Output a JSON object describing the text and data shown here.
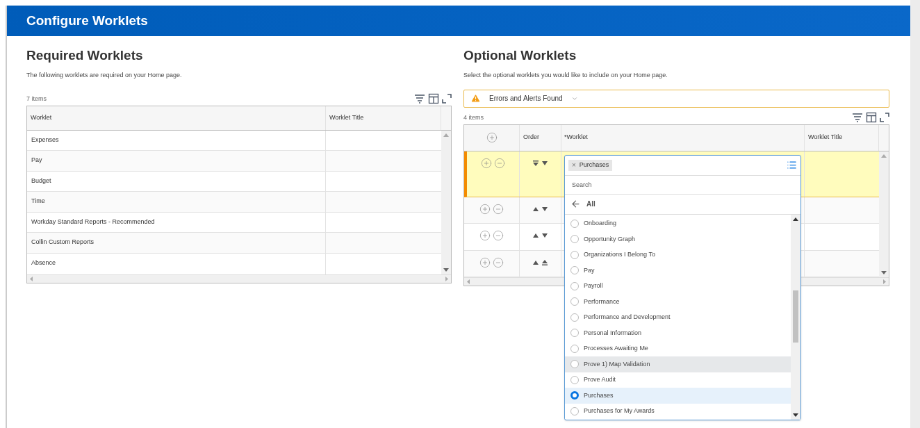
{
  "header": {
    "title": "Configure Worklets"
  },
  "required": {
    "title": "Required Worklets",
    "description": "The following worklets are required on your Home page.",
    "count": "7 items",
    "columns": [
      "Worklet",
      "Worklet Title"
    ],
    "rows": [
      {
        "worklet": "Expenses"
      },
      {
        "worklet": "Pay"
      },
      {
        "worklet": "Budget"
      },
      {
        "worklet": "Time"
      },
      {
        "worklet": "Workday Standard Reports - Recommended"
      },
      {
        "worklet": "Collin Custom Reports"
      },
      {
        "worklet": "Absence"
      }
    ]
  },
  "optional": {
    "title": "Optional Worklets",
    "description": "Select the optional worklets you would like to include on your Home page.",
    "alert": "Errors and Alerts Found",
    "count": "4 items",
    "columns": [
      "Order",
      "*Worklet",
      "Worklet Title"
    ],
    "rows": [
      {
        "selected": true,
        "order": [
          {
            "kind": "top"
          },
          {
            "kind": "down"
          }
        ]
      },
      {
        "selected": false,
        "order": [
          {
            "kind": "up"
          },
          {
            "kind": "down"
          }
        ]
      },
      {
        "selected": false,
        "order": [
          {
            "kind": "up"
          },
          {
            "kind": "down"
          }
        ]
      },
      {
        "selected": false,
        "order": [
          {
            "kind": "up"
          },
          {
            "kind": "bottom"
          }
        ]
      }
    ],
    "dropdown": {
      "chip": "Purchases",
      "chip_remove": "×",
      "search_placeholder": "Search",
      "back_label": "All",
      "options": [
        {
          "label": "Onboarding",
          "selected": false,
          "hovered": false
        },
        {
          "label": "Opportunity Graph",
          "selected": false,
          "hovered": false
        },
        {
          "label": "Organizations I Belong To",
          "selected": false,
          "hovered": false
        },
        {
          "label": "Pay",
          "selected": false,
          "hovered": false
        },
        {
          "label": "Payroll",
          "selected": false,
          "hovered": false
        },
        {
          "label": "Performance",
          "selected": false,
          "hovered": false
        },
        {
          "label": "Performance and Development",
          "selected": false,
          "hovered": false
        },
        {
          "label": "Personal Information",
          "selected": false,
          "hovered": false
        },
        {
          "label": "Processes Awaiting Me",
          "selected": false,
          "hovered": false
        },
        {
          "label": "Prove 1) Map Validation",
          "selected": false,
          "hovered": true
        },
        {
          "label": "Prove Audit",
          "selected": false,
          "hovered": false
        },
        {
          "label": "Purchases",
          "selected": true,
          "hovered": false
        },
        {
          "label": "Purchases for My Awards",
          "selected": false,
          "hovered": false
        }
      ]
    }
  }
}
